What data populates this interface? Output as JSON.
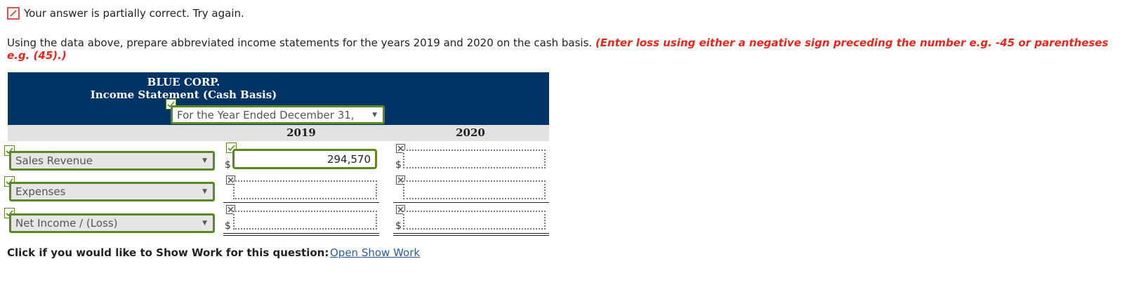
{
  "status": {
    "message": "Your answer is partially correct.  Try again."
  },
  "instructions": {
    "text": "Using the data above, prepare abbreviated income statements for the years 2019 and 2020 on the cash basis.",
    "hint": "(Enter loss using either a negative sign preceding the number e.g. -45 or parentheses e.g. (45).)"
  },
  "statement": {
    "company": "BLUE CORP.",
    "title": "Income Statement (Cash Basis)",
    "period_select": "For the Year Ended December 31,",
    "years": [
      "2019",
      "2020"
    ],
    "rows": [
      {
        "label": "Sales Revenue",
        "currency": "$",
        "value_2019": "294,570",
        "value_2020": "",
        "currency_2020": "$"
      },
      {
        "label": "Expenses",
        "currency": "",
        "value_2019": "",
        "value_2020": "",
        "currency_2020": ""
      },
      {
        "label": "Net Income / (Loss)",
        "currency": "$",
        "value_2019": "",
        "value_2020": "",
        "currency_2020": "$"
      }
    ]
  },
  "footer": {
    "prompt": "Click if you would like to Show Work for this question:",
    "link": "Open Show Work"
  },
  "colors": {
    "header_bg": "#003366",
    "correct_border": "#5a8a1f",
    "hint_red": "#e8261c",
    "link_blue": "#2a5d9f"
  }
}
